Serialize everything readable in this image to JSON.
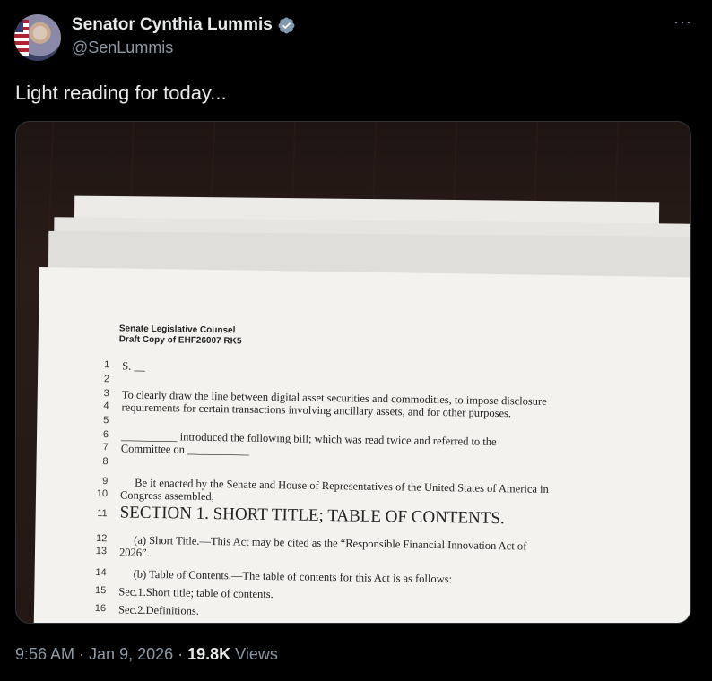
{
  "author": {
    "name": "Senator Cynthia Lummis",
    "handle": "@SenLummis",
    "verified_color": "#829aab"
  },
  "more_label": "···",
  "tweet": {
    "text": "Light reading for today..."
  },
  "document": {
    "header_line1": "Senate Legislative Counsel",
    "header_line2": "Draft Copy of EHF26007 RK5",
    "lines": [
      {
        "num": "1",
        "text": "S. __"
      },
      {
        "num": "2",
        "text": ""
      },
      {
        "num": "3",
        "text": "To clearly draw the line between digital asset securities and commodities, to impose disclosure"
      },
      {
        "num": "4",
        "text": "requirements for certain transactions involving ancillary assets, and for other purposes."
      },
      {
        "num": "5",
        "text": ""
      },
      {
        "num": "6",
        "text": "__________ introduced the following bill; which was read twice and referred to the"
      },
      {
        "num": "7",
        "text": "Committee on ___________"
      },
      {
        "num": "8",
        "text": ""
      },
      {
        "num": "9",
        "text": "Be it enacted by the Senate and House of Representatives of the United States of America in"
      },
      {
        "num": "10",
        "text": "Congress assembled,"
      },
      {
        "num": "11",
        "text": "SECTION 1. SHORT TITLE; TABLE OF CONTENTS."
      },
      {
        "num": "12",
        "text": "(a) Short Title.—This Act may be cited as the “Responsible Financial Innovation Act of"
      },
      {
        "num": "13",
        "text": "2026”."
      },
      {
        "num": "14",
        "text": "(b) Table of Contents.—The table of contents for this Act is as follows:"
      },
      {
        "num": "15",
        "text": "Sec.1.Short title; table of contents."
      },
      {
        "num": "16",
        "text": "Sec.2.Definitions."
      }
    ]
  },
  "meta": {
    "time": "9:56 AM",
    "separator": " · ",
    "date": "Jan 9, 2026",
    "views_count": "19.8K",
    "views_label": " Views"
  }
}
